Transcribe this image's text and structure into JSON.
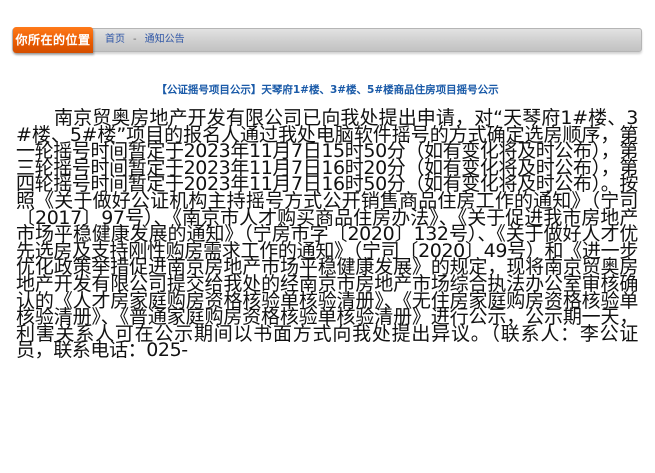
{
  "location": {
    "badge_label": "你所在的位置",
    "crumbs": [
      {
        "label": "首页"
      },
      {
        "label": "通知公告"
      }
    ],
    "separator": "-"
  },
  "article": {
    "title": "【公证摇号项目公示】天琴府1#楼、3#楼、5#楼商品住房项目摇号公示",
    "body": "南京贸奥房地产开发有限公司已向我处提出申请，对“天琴府1#楼、3#楼、5#楼”项目的报名人通过我处电脑软件摇号的方式确定选房顺序，第一轮摇号时间暂定于2023年11月7日15时50分（如有变化将及时公布），第三轮摇号时间暂定于2023年11月7日16时20分（如有变化将及时公布），第四轮摇号时间暂定于2023年11月7日16时50分（如有变化将及时公布）。按照《关于做好公证机构主持摇号方式公开销售商品住房工作的通知》（宁司〔2017〕97号）、《南京市人才购买商品住房办法》、《关于促进我市房地产市场平稳健康发展的通知》（宁房市字〔2020〕132号）、《关于做好人才优先选房及支持刚性购房需求工作的通知》（宁司〔2020〕49号）和《进一步优化政策举措促进南京房地产市场平稳健康发展》的规定，现将南京贸奥房地产开发有限公司提交给我处的经南京市房地产市场综合执法办公室审核确认的《人才房家庭购房资格核验单核验清册》、《无住房家庭购房资格核验单核验清册》、《普通家庭购房资格核验单核验清册》进行公示，公示期一天，利害关系人可在公示期间以书面方式向我处提出异议。（联系人：李公证员，联系电话：025-"
  }
}
